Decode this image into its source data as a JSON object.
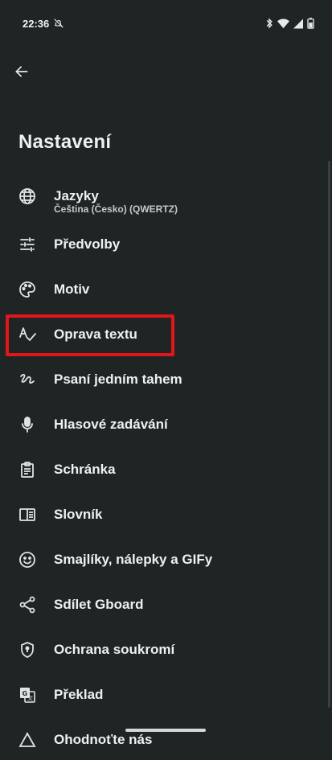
{
  "status_bar": {
    "time": "22:36",
    "left_icons": [
      "notifications-off-icon"
    ],
    "right_icons": [
      "bluetooth-icon",
      "wifi-icon",
      "signal-icon",
      "battery-icon"
    ]
  },
  "header": {
    "back_icon": "arrow-back-icon",
    "title": "Nastavení"
  },
  "settings": {
    "items": [
      {
        "icon": "globe-icon",
        "label": "Jazyky",
        "subtitle": "Čeština (Česko) (QWERTZ)"
      },
      {
        "icon": "tune-icon",
        "label": "Předvolby"
      },
      {
        "icon": "palette-icon",
        "label": "Motiv"
      },
      {
        "icon": "spellcheck-icon",
        "label": "Oprava textu",
        "highlighted": true
      },
      {
        "icon": "gesture-icon",
        "label": "Psaní jedním tahem"
      },
      {
        "icon": "mic-icon",
        "label": "Hlasové zadávání"
      },
      {
        "icon": "clipboard-icon",
        "label": "Schránka"
      },
      {
        "icon": "dictionary-icon",
        "label": "Slovník"
      },
      {
        "icon": "emoji-icon",
        "label": "Smajlíky, nálepky a GIFy"
      },
      {
        "icon": "share-icon",
        "label": "Sdílet Gboard"
      },
      {
        "icon": "shield-icon",
        "label": "Ochrana soukromí"
      },
      {
        "icon": "translate-icon",
        "label": "Překlad"
      },
      {
        "icon": "info-icon",
        "label": "Ohodnoťte nás"
      }
    ]
  },
  "colors": {
    "background": "#1f2425",
    "text": "#eef1f2",
    "highlight_border": "#e0161b"
  }
}
